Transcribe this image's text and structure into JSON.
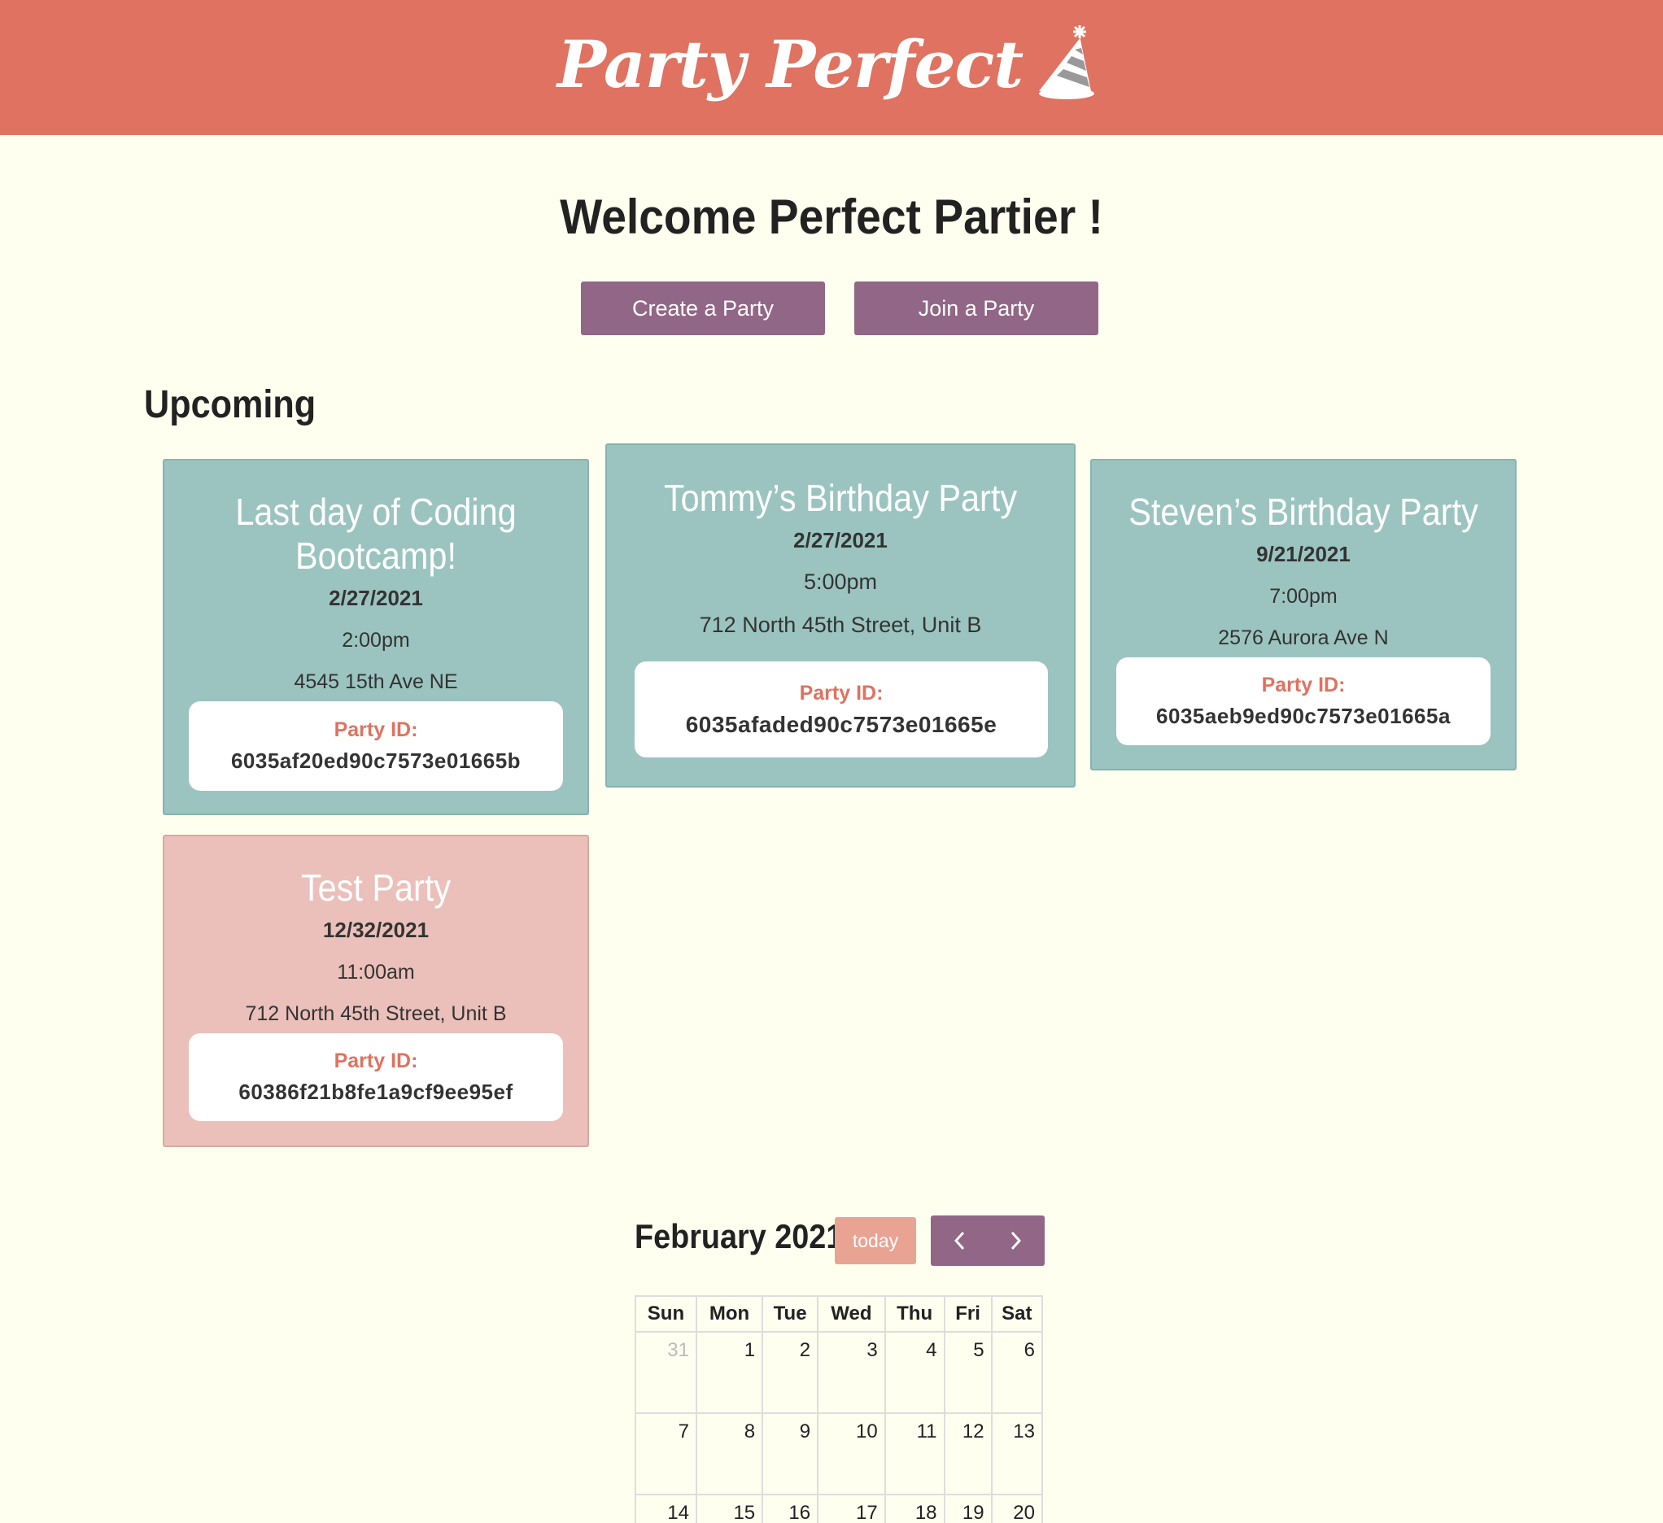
{
  "header": {
    "brand": "Party Perfect",
    "logo_icon": "party-hat-icon"
  },
  "welcome": "Welcome Perfect Partier !",
  "actions": {
    "create_label": "Create a Party",
    "join_label": "Join a Party"
  },
  "upcoming_title": "Upcoming",
  "parties": [
    {
      "title": "Last day of Coding Bootcamp!",
      "date": "2/27/2021",
      "time": "2:00pm",
      "address": "4545 15th Ave NE",
      "id_label": "Party ID:",
      "id": "6035af20ed90c7573e01665b"
    },
    {
      "title": "Tommy’s Birthday Party",
      "date": "2/27/2021",
      "time": "5:00pm",
      "address": "712 North 45th Street, Unit B",
      "id_label": "Party ID:",
      "id": "6035afaded90c7573e01665e"
    },
    {
      "title": "Steven’s Birthday Party",
      "date": "9/21/2021",
      "time": "7:00pm",
      "address": "2576 Aurora Ave N",
      "id_label": "Party ID:",
      "id": "6035aeb9ed90c7573e01665a"
    },
    {
      "title": "Test Party",
      "date": "12/32/2021",
      "time": "11:00am",
      "address": "712 North 45th Street, Unit B",
      "id_label": "Party ID:",
      "id": "60386f21b8fe1a9cf9ee95ef"
    }
  ],
  "calendar": {
    "title": "February 2021",
    "today_label": "today",
    "prev_icon": "chevron-left-icon",
    "next_icon": "chevron-right-icon",
    "days": [
      "Sun",
      "Mon",
      "Tue",
      "Wed",
      "Thu",
      "Fri",
      "Sat"
    ],
    "weeks": [
      [
        "31",
        "1",
        "2",
        "3",
        "4",
        "5",
        "6"
      ],
      [
        "7",
        "8",
        "9",
        "10",
        "11",
        "12",
        "13"
      ],
      [
        "14",
        "15",
        "16",
        "17",
        "18",
        "19",
        "20"
      ]
    ]
  },
  "colors": {
    "header": "#df7260",
    "background": "#fffff0",
    "button": "#926686",
    "card_teal": "#9bc4c0",
    "card_pink": "#ebc0ba",
    "id_label": "#df7260",
    "today": "#e9a393"
  }
}
